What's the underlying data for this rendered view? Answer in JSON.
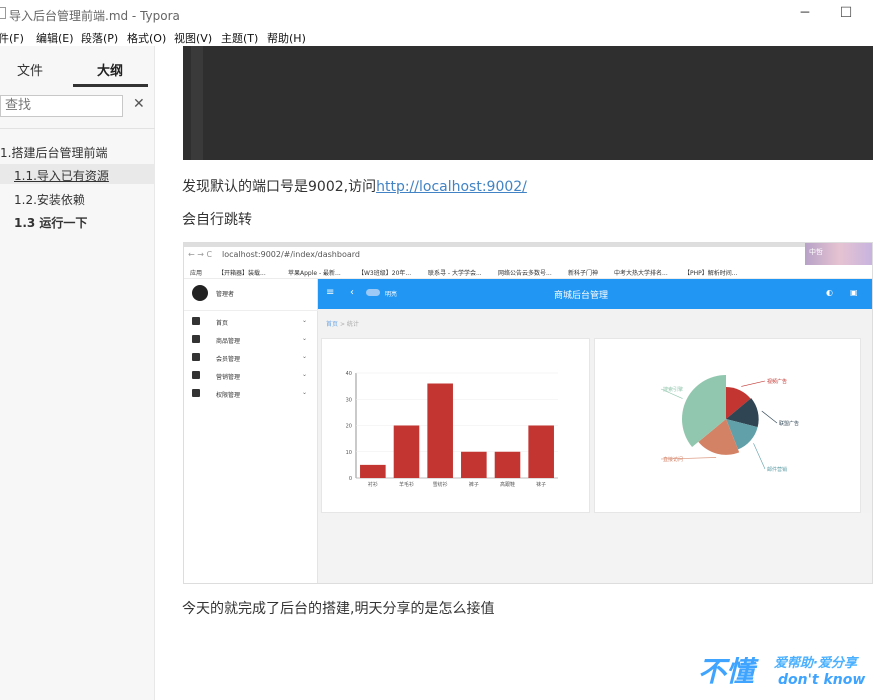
{
  "window": {
    "title": "导入后台管理前端.md - Typora",
    "minimize_symbol": "─",
    "maximize_symbol": "☐"
  },
  "menu": [
    "件(F)",
    "编辑(E)",
    "段落(P)",
    "格式(O)",
    "视图(V)",
    "主题(T)",
    "帮助(H)"
  ],
  "sidebar": {
    "tabs": [
      {
        "label": "文件"
      },
      {
        "label": "大纲"
      }
    ],
    "search_placeholder": "查找",
    "close_symbol": "✕",
    "outline": [
      {
        "label": "1.搭建后台管理前端"
      },
      {
        "label": "1.1.导入已有资源"
      },
      {
        "label": "1.2.安装依赖"
      },
      {
        "label": "1.3 运行一下"
      }
    ]
  },
  "content": {
    "p1_text": "发现默认的端口号是9002,访问",
    "p1_link": "http://localhost:9002/",
    "p2_text": "会自行跳转",
    "p3_text": "今天的就完成了后台的搭建,明天分享的是怎么接值"
  },
  "screenshot": {
    "address": "localhost:9002/#/index/dashboard",
    "anime_text": "中哲",
    "bookmarks": [
      "应用",
      "【开箱器】装载...",
      "苹果Apple - 最新...",
      "【W3班级】20年...",
      "联系寻 - 大学学会...",
      "网络公告云多数号...",
      "新科子门神",
      "中考大热大学排名...",
      "【PHP】解析时间..."
    ],
    "sidebar_user": "管理者",
    "sidebar_items": [
      {
        "label": "首页",
        "icon": "home-icon"
      },
      {
        "label": "商品管理",
        "icon": "grid-icon"
      },
      {
        "label": "会员管理",
        "icon": "users-icon"
      },
      {
        "label": "营销管理",
        "icon": "dollar-icon"
      },
      {
        "label": "权限管理",
        "icon": "gear-icon"
      }
    ],
    "header_title": "商城后台管理",
    "header_toggle": "明亮",
    "breadcrumb": [
      "首页",
      "统计"
    ],
    "bar_chart": {
      "type": "bar",
      "categories": [
        "衬衫",
        "羊毛衫",
        "雪纺衫",
        "裤子",
        "高跟鞋",
        "袜子"
      ],
      "values": [
        5,
        20,
        36,
        10,
        10,
        20
      ],
      "ylim": [
        0,
        40
      ],
      "yticks": [
        0,
        10,
        20,
        30,
        40
      ],
      "color": "#c23531"
    },
    "pie_chart": {
      "type": "pie",
      "labels": [
        "视频广告",
        "联盟广告",
        "邮件营销",
        "直接访问",
        "搜索引擎"
      ],
      "colors": [
        "#c23531",
        "#2f4554",
        "#61a0a8",
        "#d48265",
        "#91c7ae"
      ],
      "values": [
        14,
        15,
        15,
        20,
        36
      ]
    }
  },
  "watermark": {
    "big": "不懂",
    "line1": "爱帮助·爱分享",
    "line2": "don't know"
  }
}
